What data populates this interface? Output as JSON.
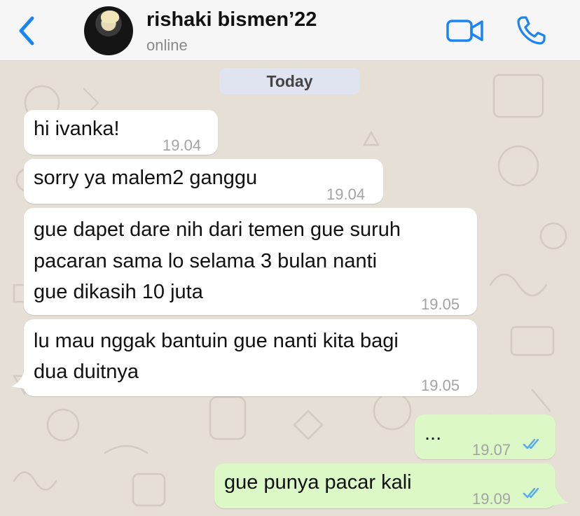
{
  "header": {
    "contact_name": "rishaki bismen’22",
    "status": "online"
  },
  "date_separator": "Today",
  "messages": [
    {
      "direction": "incoming",
      "lines": [
        "hi ivanka!"
      ],
      "time": "19.04"
    },
    {
      "direction": "incoming",
      "lines": [
        "sorry ya malem2 ganggu"
      ],
      "time": "19.04"
    },
    {
      "direction": "incoming",
      "lines": [
        "gue dapet dare nih dari temen gue suruh",
        "pacaran sama lo selama 3 bulan nanti",
        "gue dikasih 10 juta"
      ],
      "time": "19.05"
    },
    {
      "direction": "incoming",
      "lines": [
        "lu mau nggak bantuin gue nanti kita bagi",
        "dua duitnya"
      ],
      "time": "19.05"
    },
    {
      "direction": "outgoing",
      "lines": [
        "..."
      ],
      "time": "19.07",
      "read": true
    },
    {
      "direction": "outgoing",
      "lines": [
        "gue punya pacar kali"
      ],
      "time": "19.09",
      "read": true
    }
  ],
  "icons": {
    "back": "chevron-left-icon",
    "video_call": "video-camera-icon",
    "voice_call": "phone-icon",
    "read_receipt": "double-check-icon"
  },
  "colors": {
    "accent": "#1a85f0",
    "incoming_bubble": "#ffffff",
    "outgoing_bubble": "#dcf8c6",
    "chat_background": "#e5dfd6",
    "read_tick": "#53a9eb"
  }
}
